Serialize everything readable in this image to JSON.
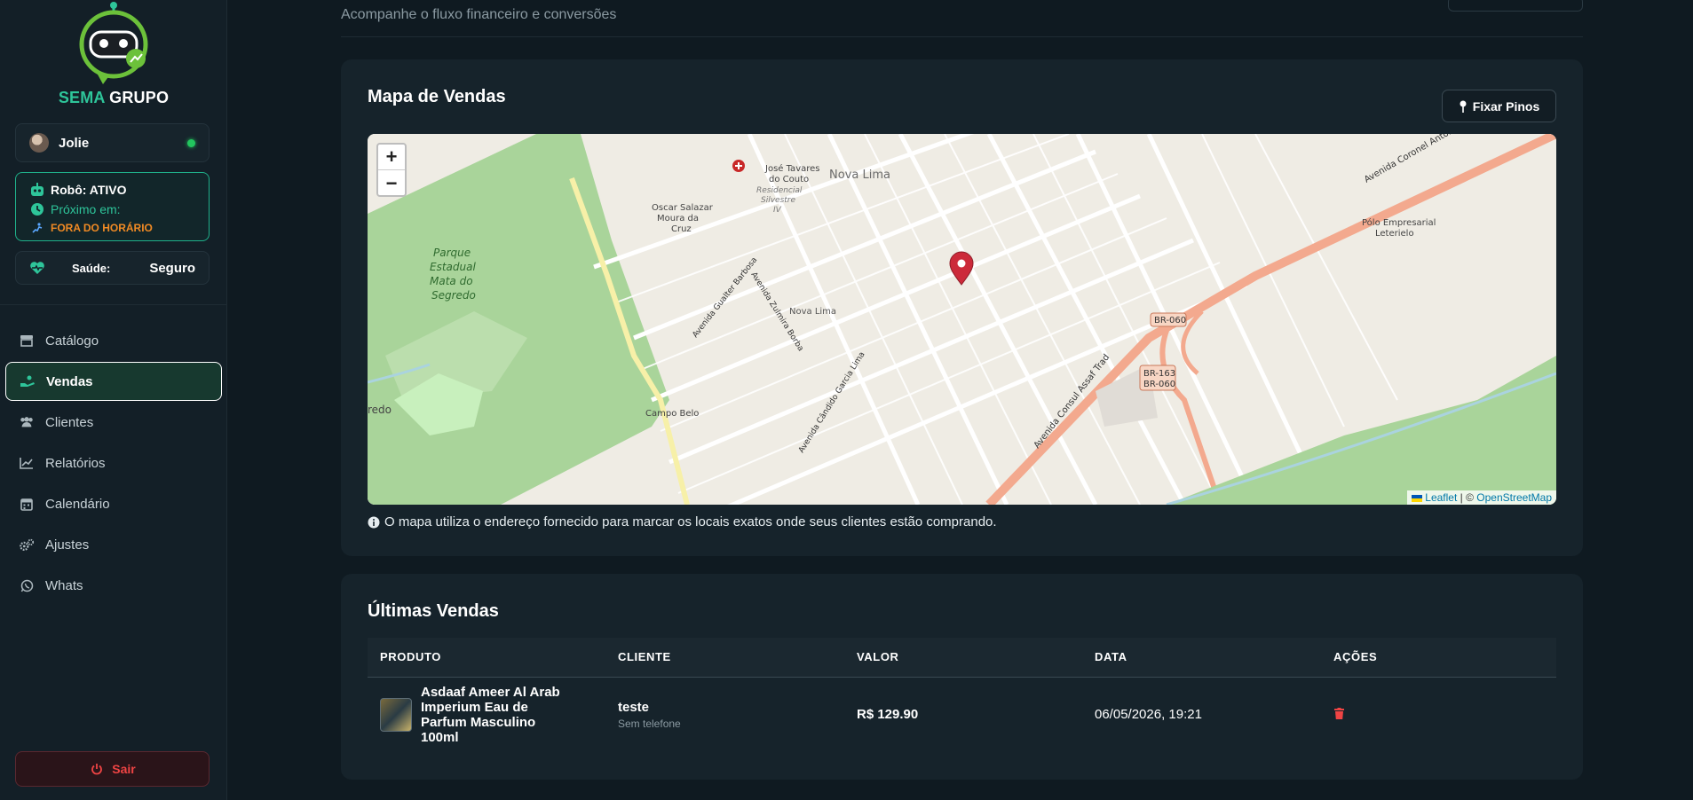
{
  "brand": {
    "name_part1": "SEMA",
    "name_part2": "GRUPO"
  },
  "user": {
    "name": "Jolie",
    "online": true
  },
  "robot": {
    "status_label": "Robô: ATIVO",
    "next_label": "Próximo em:",
    "next_value": "FORA DO HORÁRIO"
  },
  "health": {
    "label": "Saúde:",
    "value": "Seguro"
  },
  "nav": {
    "items": [
      {
        "label": "Catálogo",
        "icon": "store-icon"
      },
      {
        "label": "Vendas",
        "icon": "hand-coins-icon",
        "active": true
      },
      {
        "label": "Clientes",
        "icon": "users-icon"
      },
      {
        "label": "Relatórios",
        "icon": "chart-line-icon"
      },
      {
        "label": "Calendário",
        "icon": "calendar-icon"
      },
      {
        "label": "Ajustes",
        "icon": "gears-icon"
      },
      {
        "label": "Whats",
        "icon": "whatsapp-icon"
      }
    ],
    "logout_label": "Sair"
  },
  "page": {
    "subtitle": "Acompanhe o fluxo financeiro e conversões"
  },
  "map_panel": {
    "title": "Mapa de Vendas",
    "pin_button_label": "Fixar Pinos",
    "zoom_in": "+",
    "zoom_out": "−",
    "attribution_leaflet": "Leaflet",
    "attribution_sep": "| ©",
    "attribution_osm": "OpenStreetMap",
    "note": "O mapa utiliza o endereço fornecido para marcar os locais exatos onde seus clientes estão comprando.",
    "labels": {
      "nova_lima": "Nova Lima",
      "nova_lima_2": "Nova Lima",
      "parque": "Parque Estadual Mata do Segredo",
      "jose_tavares": "José Tavares do Couto",
      "oscar": "Oscar Salazar Moura da Cruz",
      "residencial": "Residencial Silvestre IV",
      "polo": "Pólo Empresarial Leterielo",
      "campo_belo": "Campo Belo",
      "br060": "BR-060",
      "br163": "BR-163",
      "br060b": "BR-060",
      "av_coronel": "Avenida Coronel Antonino",
      "av_consul": "Avenida Consul Assaf Trad",
      "av_zulmira": "Avenida Zulmira Borba",
      "av_candido": "Avenida Cândido Garcia Lima",
      "av_gualter": "Avenida Gualter Barbosa",
      "redo": "redo"
    }
  },
  "sales_panel": {
    "title": "Últimas Vendas",
    "columns": [
      "PRODUTO",
      "CLIENTE",
      "VALOR",
      "DATA",
      "AÇÕES"
    ],
    "rows": [
      {
        "product": "Asdaaf Ameer Al Arab Imperium Eau de Parfum Masculino 100ml",
        "client": "teste",
        "phone": "Sem telefone",
        "value": "R$ 129.90",
        "date": "06/05/2026, 19:21"
      }
    ]
  },
  "colors": {
    "accent": "#2ec59a",
    "warning": "#f08a24",
    "danger": "#ef4444",
    "background": "#0f1a21",
    "panel": "#16232b"
  }
}
